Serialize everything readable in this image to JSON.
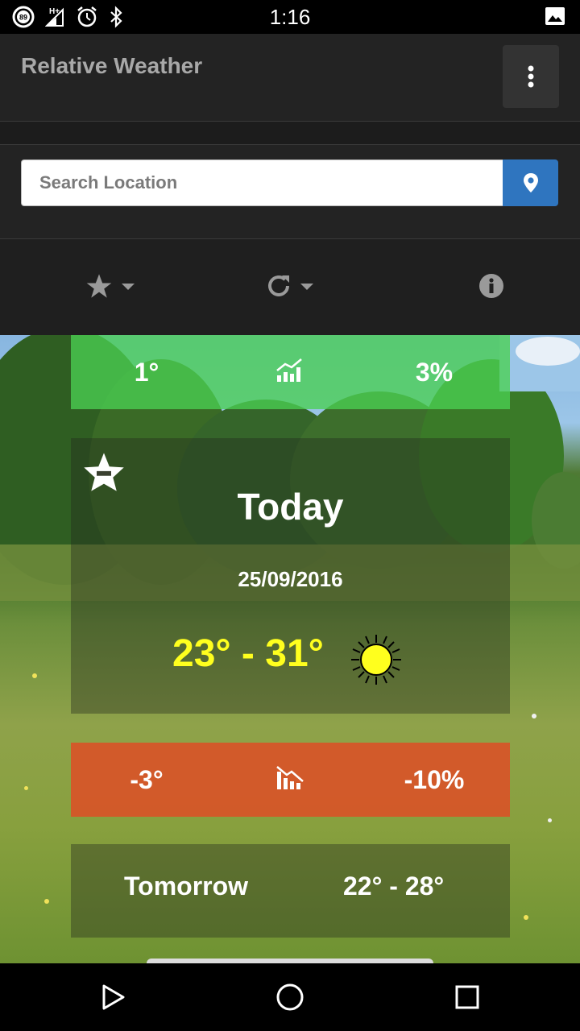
{
  "status_bar": {
    "time": "1:16",
    "battery_level": "89",
    "network_label": "H+",
    "icons": [
      "battery-icon",
      "signal-icon",
      "alarm-icon",
      "bluetooth-icon",
      "image-notification-icon"
    ]
  },
  "app_bar": {
    "title": "Relative Weather",
    "menu_icon": "more-vert-icon"
  },
  "search": {
    "placeholder": "Search Location",
    "button_icon": "map-marker-icon"
  },
  "toolbar": {
    "favorites_icon": "star-icon",
    "refresh_icon": "refresh-icon",
    "info_icon": "info-icon"
  },
  "comparison_up": {
    "temp_diff": "1°",
    "icon": "trend-up-chart-icon",
    "percent_diff": "3%",
    "color": "#4ad052"
  },
  "today": {
    "title": "Today",
    "date": "25/09/2016",
    "temp_range": "23° - 31°",
    "condition_icon": "sun-icon",
    "favorite_icon": "star-remove-icon",
    "temp_color": "#ffff1e"
  },
  "comparison_down": {
    "temp_diff": "-3°",
    "icon": "trend-down-chart-icon",
    "percent_diff": "-10%",
    "color": "#de4e26"
  },
  "tomorrow": {
    "label": "Tomorrow",
    "temp_range": "22° - 28°"
  },
  "nav_bar": {
    "icons": [
      "back-icon",
      "home-icon",
      "recents-icon"
    ]
  },
  "accent_color": "#2f75bf"
}
